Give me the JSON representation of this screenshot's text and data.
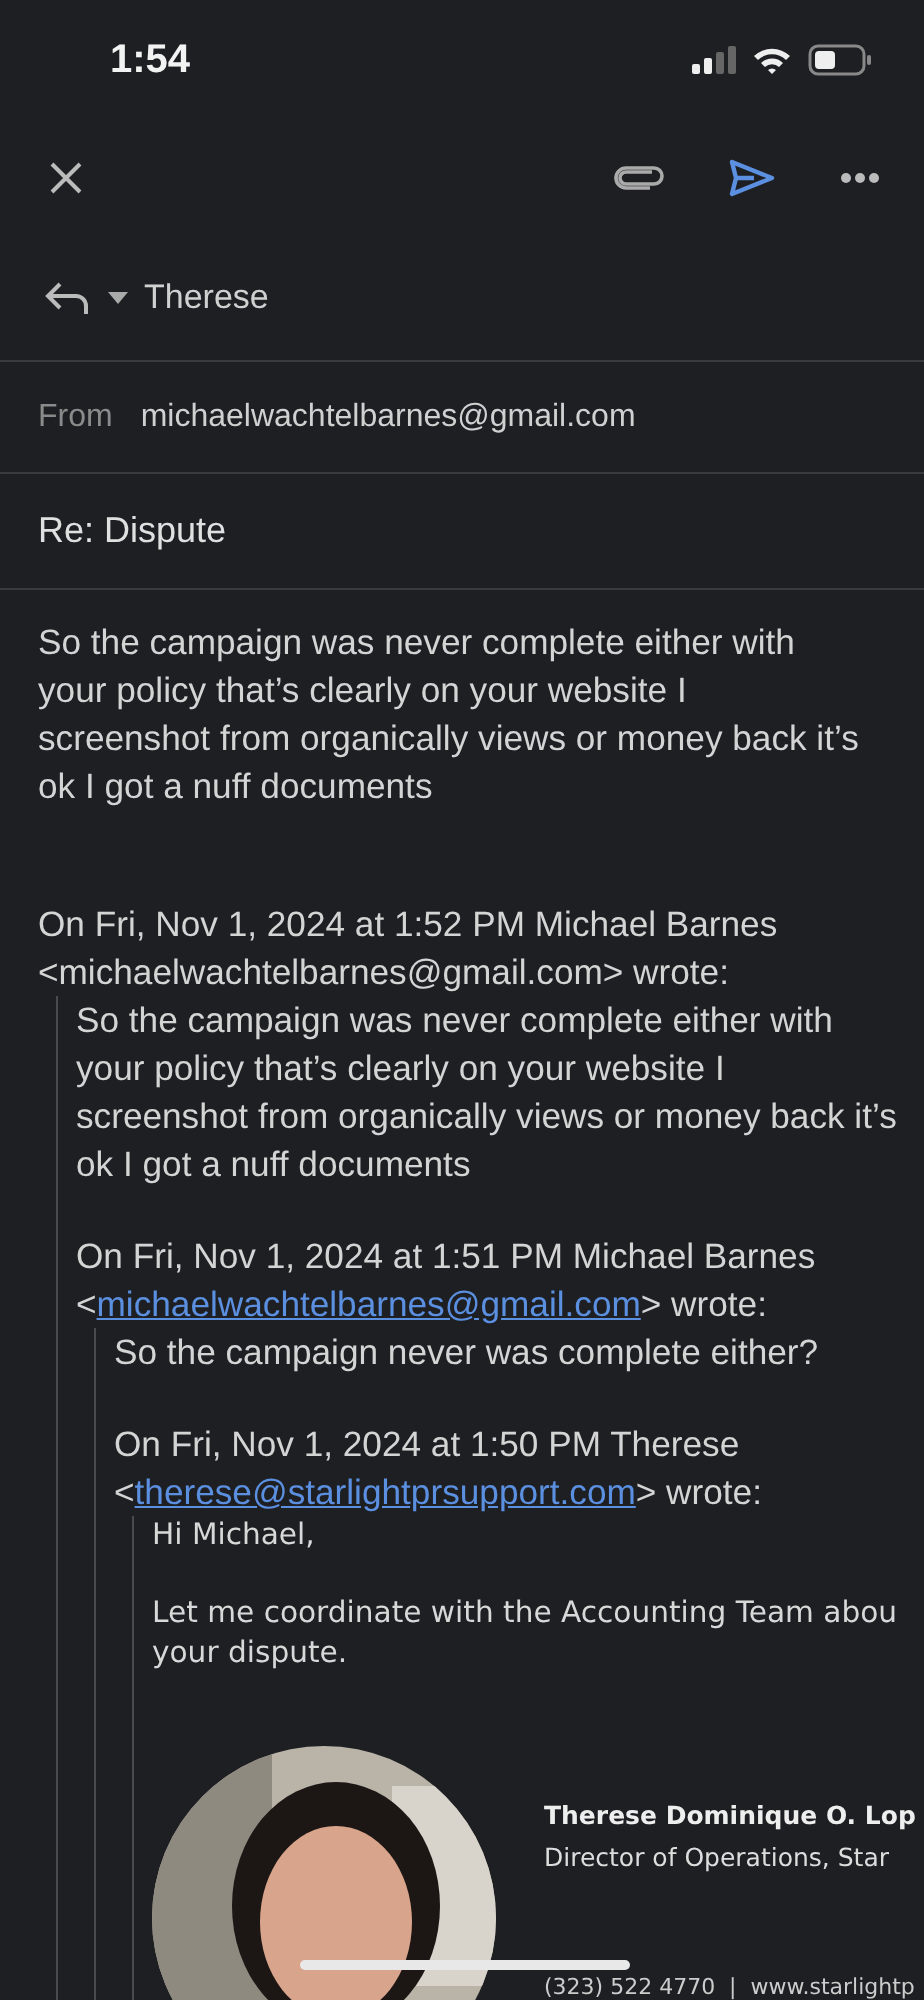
{
  "status_bar": {
    "time": "1:54"
  },
  "toolbar": {
    "actions": [
      {
        "kind": "attach"
      },
      {
        "kind": "send"
      },
      {
        "kind": "more"
      }
    ]
  },
  "reply": {
    "recipient": "Therese"
  },
  "from": {
    "label": "From",
    "address": "michaelwachtelbarnes@gmail.com"
  },
  "subject": "Re: Dispute",
  "body": "So the campaign was never complete either with your policy that’s clearly on your website I screenshot from organically views or money back it’s ok I got a nuff documents",
  "quote": {
    "header": "On Fri, Nov 1, 2024 at 1:52 PM Michael Barnes",
    "prefix": "<",
    "email": "michaelwachtelbarnes@gmail.com",
    "suffix": "> wrote:",
    "linked": false,
    "paragraphs": [
      "So the campaign was never complete either with your policy that’s clearly on your website I screenshot from organically views or money back it’s ok I got a nuff documents"
    ],
    "quote": {
      "header": "On Fri, Nov 1, 2024 at 1:51 PM Michael Barnes",
      "prefix": "<",
      "email": "michaelwachtelbarnes@gmail.com",
      "suffix": "> wrote:",
      "linked": true,
      "paragraphs": [
        "So the campaign never was complete either?"
      ],
      "quote": {
        "header": "On Fri, Nov 1, 2024 at 1:50 PM Therese",
        "prefix": "<",
        "email": "therese@starlightprsupport.com",
        "suffix": "> wrote:",
        "linked": true,
        "paragraphs": [
          "Hi Michael,",
          "Let me coordinate with the Accounting Team abou\nyour dispute."
        ],
        "signature": {
          "name": "Therese Dominique O. Lop",
          "title": "Director of Operations, Star",
          "contact": "(323) 522 4770  |  www.starlightp"
        }
      }
    }
  }
}
